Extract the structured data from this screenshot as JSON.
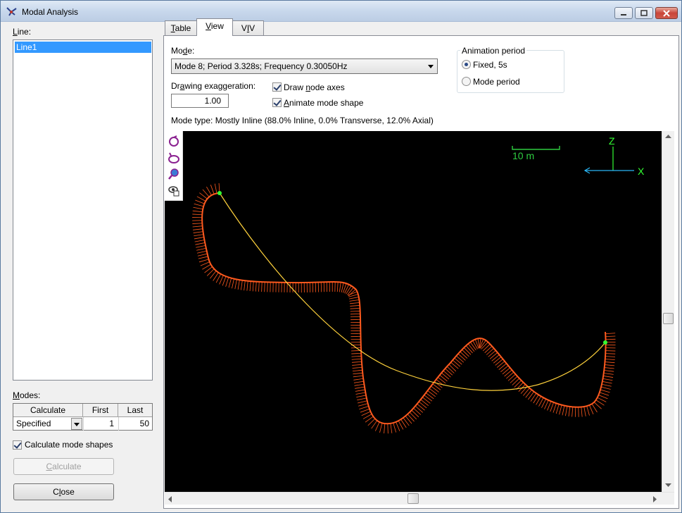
{
  "window": {
    "title": "Modal Analysis"
  },
  "left": {
    "line_label": "Line:",
    "lines": [
      "Line1"
    ],
    "modes_label": "Modes:",
    "modes_table": {
      "headers": [
        "Calculate",
        "First",
        "Last"
      ],
      "row": {
        "calculate": "Specified",
        "first": "1",
        "last": "50"
      }
    },
    "calc_shapes_label": "Calculate mode shapes",
    "calc_shapes_checked": true,
    "calculate_button": "Calculate",
    "close_button": "Close"
  },
  "tabs": [
    {
      "label": "Table",
      "active": false
    },
    {
      "label": "View",
      "active": true
    },
    {
      "label": "VIV",
      "active": false
    }
  ],
  "view": {
    "mode_label": "Mode:",
    "mode_value": "Mode 8; Period 3.328s; Frequency 0.30050Hz",
    "exaggeration_label": "Drawing exaggeration:",
    "exaggeration_value": "1.00",
    "draw_node_axes_label": "Draw node axes",
    "draw_node_axes_checked": true,
    "animate_label": "Animate mode shape",
    "animate_checked": true,
    "animation_period_title": "Animation period",
    "period_options": [
      {
        "label": "Fixed, 5s",
        "selected": true
      },
      {
        "label": "Mode period",
        "selected": false
      }
    ],
    "mode_type": "Mode type: Mostly Inline (88.0% Inline, 0.0% Transverse, 12.0% Axial)",
    "scale_label": "10 m",
    "axis_z": "Z",
    "axis_x": "X",
    "colors": {
      "background": "#000000",
      "mode_shape": "#ff5a1e",
      "static_line": "#ffd23c",
      "node_end": "#33ff33",
      "scale": "#2ecc40",
      "axis_z_line": "#33ff33",
      "axis_x_line": "#29b6f6"
    },
    "tool_icons": [
      "rotate-icon",
      "rotate-reverse-icon",
      "zoom-icon",
      "view-settings-icon"
    ]
  }
}
